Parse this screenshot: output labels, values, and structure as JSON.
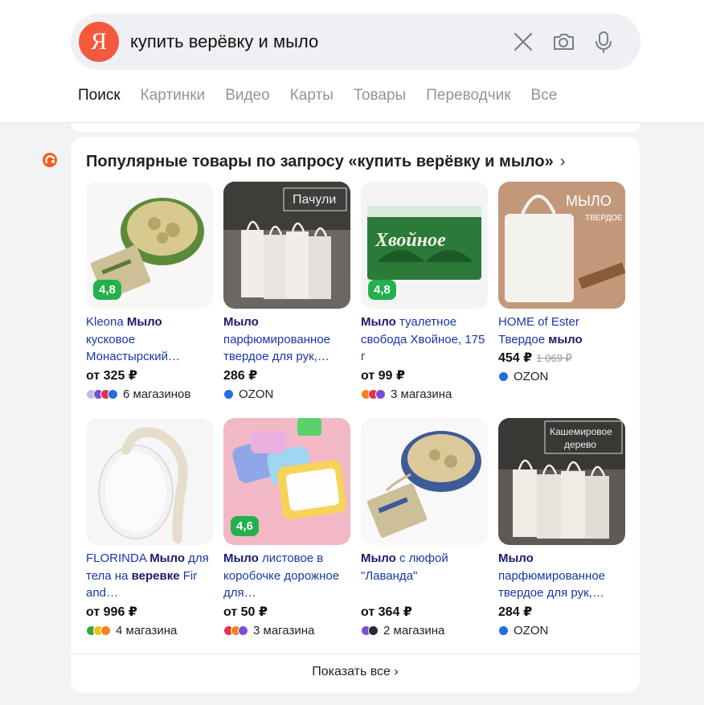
{
  "search": {
    "logo_letter": "Я",
    "query": "купить верёвку и мыло",
    "icons": [
      "clear-icon",
      "camera-icon",
      "mic-icon"
    ]
  },
  "tabs": [
    {
      "label": "Поиск",
      "active": true
    },
    {
      "label": "Картинки",
      "active": false
    },
    {
      "label": "Видео",
      "active": false
    },
    {
      "label": "Карты",
      "active": false
    },
    {
      "label": "Товары",
      "active": false
    },
    {
      "label": "Переводчик",
      "active": false
    },
    {
      "label": "Все",
      "active": false
    }
  ],
  "card": {
    "title": "Популярные товары по запросу «купить верёвку и мыло»",
    "show_all": "Показать все",
    "products": [
      {
        "rating": "4,8",
        "title_parts": [
          {
            "t": "Kleona ",
            "b": false
          },
          {
            "t": "Мыло",
            "b": true
          },
          {
            "t": " кусковое Монастырский…",
            "b": false
          }
        ],
        "price": "от 325 ₽",
        "old_price": "",
        "shops": "6 магазинов",
        "shop_colors": [
          "#b9c3d6",
          "#7a4fd6",
          "#e2334b",
          "#1f6fe0"
        ],
        "image_label": "",
        "thumb": "loofah-green"
      },
      {
        "rating": "",
        "title_parts": [
          {
            "t": "Мыло",
            "b": true
          },
          {
            "t": " парфюмированное твердое для рук,…",
            "b": false
          }
        ],
        "price": "286 ₽",
        "old_price": "",
        "shops": "OZON",
        "shop_colors": [
          "#1f6fe0"
        ],
        "image_label": "Пачули",
        "thumb": "bars-dark"
      },
      {
        "rating": "4,8",
        "title_parts": [
          {
            "t": "Мыло",
            "b": true
          },
          {
            "t": " туалетное свобода Хвойное, 175 г",
            "b": false
          }
        ],
        "price": "от 99 ₽",
        "old_price": "",
        "shops": "3 магазина",
        "shop_colors": [
          "#f58220",
          "#e2334b",
          "#7a4fd6"
        ],
        "image_label": "Хвойное",
        "thumb": "green-pack"
      },
      {
        "rating": "",
        "title_parts": [
          {
            "t": "HOME of Ester Твердое ",
            "b": false
          },
          {
            "t": "мыло",
            "b": true
          }
        ],
        "price": "454 ₽",
        "old_price": "1 069 ₽",
        "shops": "OZON",
        "shop_colors": [
          "#1f6fe0"
        ],
        "image_label": "МЫЛО ТВЕРДОЕ",
        "thumb": "white-bar"
      },
      {
        "rating": "",
        "title_parts": [
          {
            "t": "FLORINDA ",
            "b": false
          },
          {
            "t": "Мыло",
            "b": true
          },
          {
            "t": " для тела на ",
            "b": false
          },
          {
            "t": "веревке",
            "b": true
          },
          {
            "t": " Fir and…",
            "b": false
          }
        ],
        "price": "от 996 ₽",
        "old_price": "",
        "shops": "4 магазина",
        "shop_colors": [
          "#3aa935",
          "#f2c21b",
          "#f58220"
        ],
        "image_label": "",
        "thumb": "oval-rope"
      },
      {
        "rating": "4,6",
        "title_parts": [
          {
            "t": "Мыло",
            "b": true
          },
          {
            "t": " листовое в коробочке дорожное для…",
            "b": false
          }
        ],
        "price": "от 50 ₽",
        "old_price": "",
        "shops": "3 магазина",
        "shop_colors": [
          "#e2334b",
          "#f58220",
          "#7a4fd6"
        ],
        "image_label": "",
        "thumb": "paper-soap"
      },
      {
        "rating": "",
        "title_parts": [
          {
            "t": "Мыло",
            "b": true
          },
          {
            "t": " с люфой \"Лаванда\"",
            "b": false
          }
        ],
        "price": "от 364 ₽",
        "old_price": "",
        "shops": "2 магазина",
        "shop_colors": [
          "#7a4fd6",
          "#2b2b2b"
        ],
        "image_label": "",
        "thumb": "loofah-blue"
      },
      {
        "rating": "",
        "title_parts": [
          {
            "t": "Мыло",
            "b": true
          },
          {
            "t": " парфюмированное твердое для рук,…",
            "b": false
          }
        ],
        "price": "284 ₽",
        "old_price": "",
        "shops": "OZON",
        "shop_colors": [
          "#1f6fe0"
        ],
        "image_label": "Кашемировое дерево",
        "thumb": "bars-dark2"
      }
    ]
  }
}
